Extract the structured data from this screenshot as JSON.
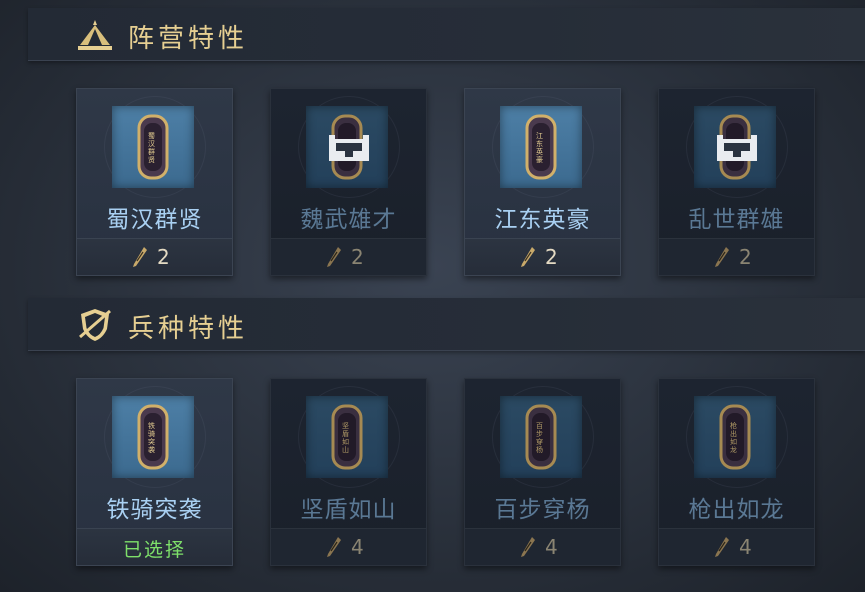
{
  "faction_section": {
    "title": "阵营特性",
    "icon": "tent-icon",
    "cards": [
      {
        "name": "蜀汉群贤",
        "cost": "2",
        "locked": false,
        "emblem_text": "蜀汉群贤"
      },
      {
        "name": "魏武雄才",
        "cost": "2",
        "locked": true,
        "emblem_text": ""
      },
      {
        "name": "江东英豪",
        "cost": "2",
        "locked": false,
        "emblem_text": "江东英豪"
      },
      {
        "name": "乱世群雄",
        "cost": "2",
        "locked": true,
        "emblem_text": ""
      }
    ]
  },
  "troop_section": {
    "title": "兵种特性",
    "icon": "shield-icon",
    "cards": [
      {
        "name": "铁骑突袭",
        "status": "已选择",
        "selected": true,
        "emblem_text": "铁骑突袭"
      },
      {
        "name": "坚盾如山",
        "cost": "4",
        "locked": true,
        "emblem_text": "坚盾如山"
      },
      {
        "name": "百步穿杨",
        "cost": "4",
        "locked": true,
        "emblem_text": "百步穿杨"
      },
      {
        "name": "枪出如龙",
        "cost": "4",
        "locked": true,
        "emblem_text": "枪出如龙"
      }
    ]
  },
  "colors": {
    "title_gold": "#e6cf92",
    "name_active": "#a9d0f2",
    "name_locked": "#5a7894",
    "selected_green": "#7ee06a"
  }
}
